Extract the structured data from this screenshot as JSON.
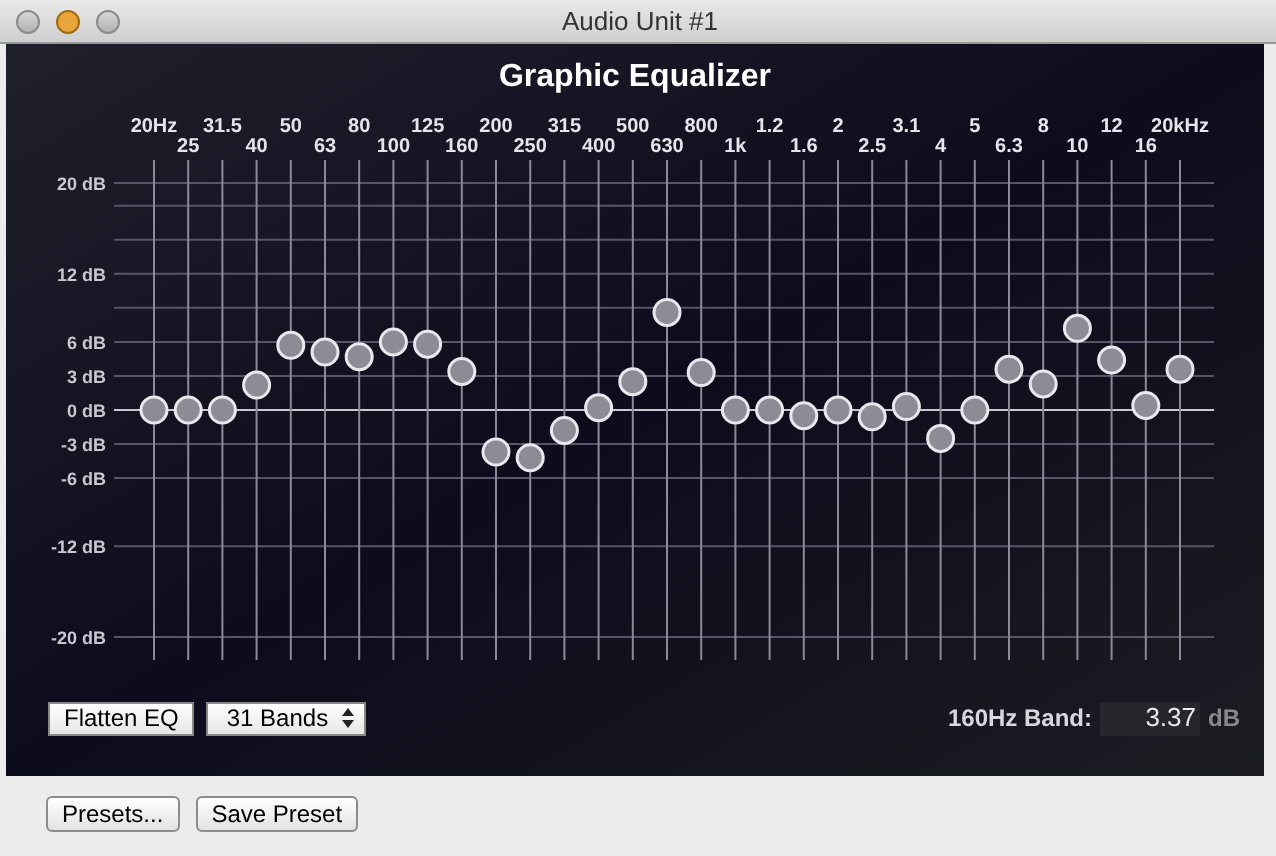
{
  "window": {
    "title": "Audio Unit #1"
  },
  "equalizer": {
    "title": "Graphic Equalizer",
    "chart_data": {
      "type": "scatter",
      "categories": [
        "20Hz",
        "25",
        "31.5",
        "40",
        "50",
        "63",
        "80",
        "100",
        "125",
        "160",
        "200",
        "250",
        "315",
        "400",
        "500",
        "630",
        "800",
        "1k",
        "1.2",
        "1.6",
        "2",
        "2.5",
        "3.1",
        "4",
        "5",
        "6.3",
        "8",
        "10",
        "12",
        "16",
        "20kHz"
      ],
      "values": [
        0,
        0,
        0,
        2.2,
        5.7,
        5.1,
        4.7,
        6.0,
        5.8,
        3.4,
        -3.7,
        -4.2,
        -1.8,
        0.2,
        2.5,
        8.6,
        3.3,
        0,
        0,
        -0.5,
        0,
        -0.6,
        0.3,
        -2.5,
        0,
        3.6,
        2.3,
        7.2,
        4.4,
        0.4,
        3.6
      ],
      "ylim": [
        -20,
        20
      ],
      "grid": true,
      "yticks": [
        {
          "value": 20,
          "label": "20 dB"
        },
        {
          "value": 12,
          "label": "12 dB"
        },
        {
          "value": 6,
          "label": "6 dB"
        },
        {
          "value": 3,
          "label": "3 dB"
        },
        {
          "value": 0,
          "label": "0 dB"
        },
        {
          "value": -3,
          "label": "-3 dB"
        },
        {
          "value": -6,
          "label": "-6 dB"
        },
        {
          "value": -12,
          "label": "-12 dB"
        },
        {
          "value": -20,
          "label": "-20 dB"
        }
      ]
    },
    "flatten_button": "Flatten EQ",
    "bands_select": "31 Bands",
    "band_label": "160Hz Band:",
    "band_value": "3.37",
    "band_unit": "dB"
  },
  "buttons": [
    "Presets...",
    "Save Preset"
  ]
}
